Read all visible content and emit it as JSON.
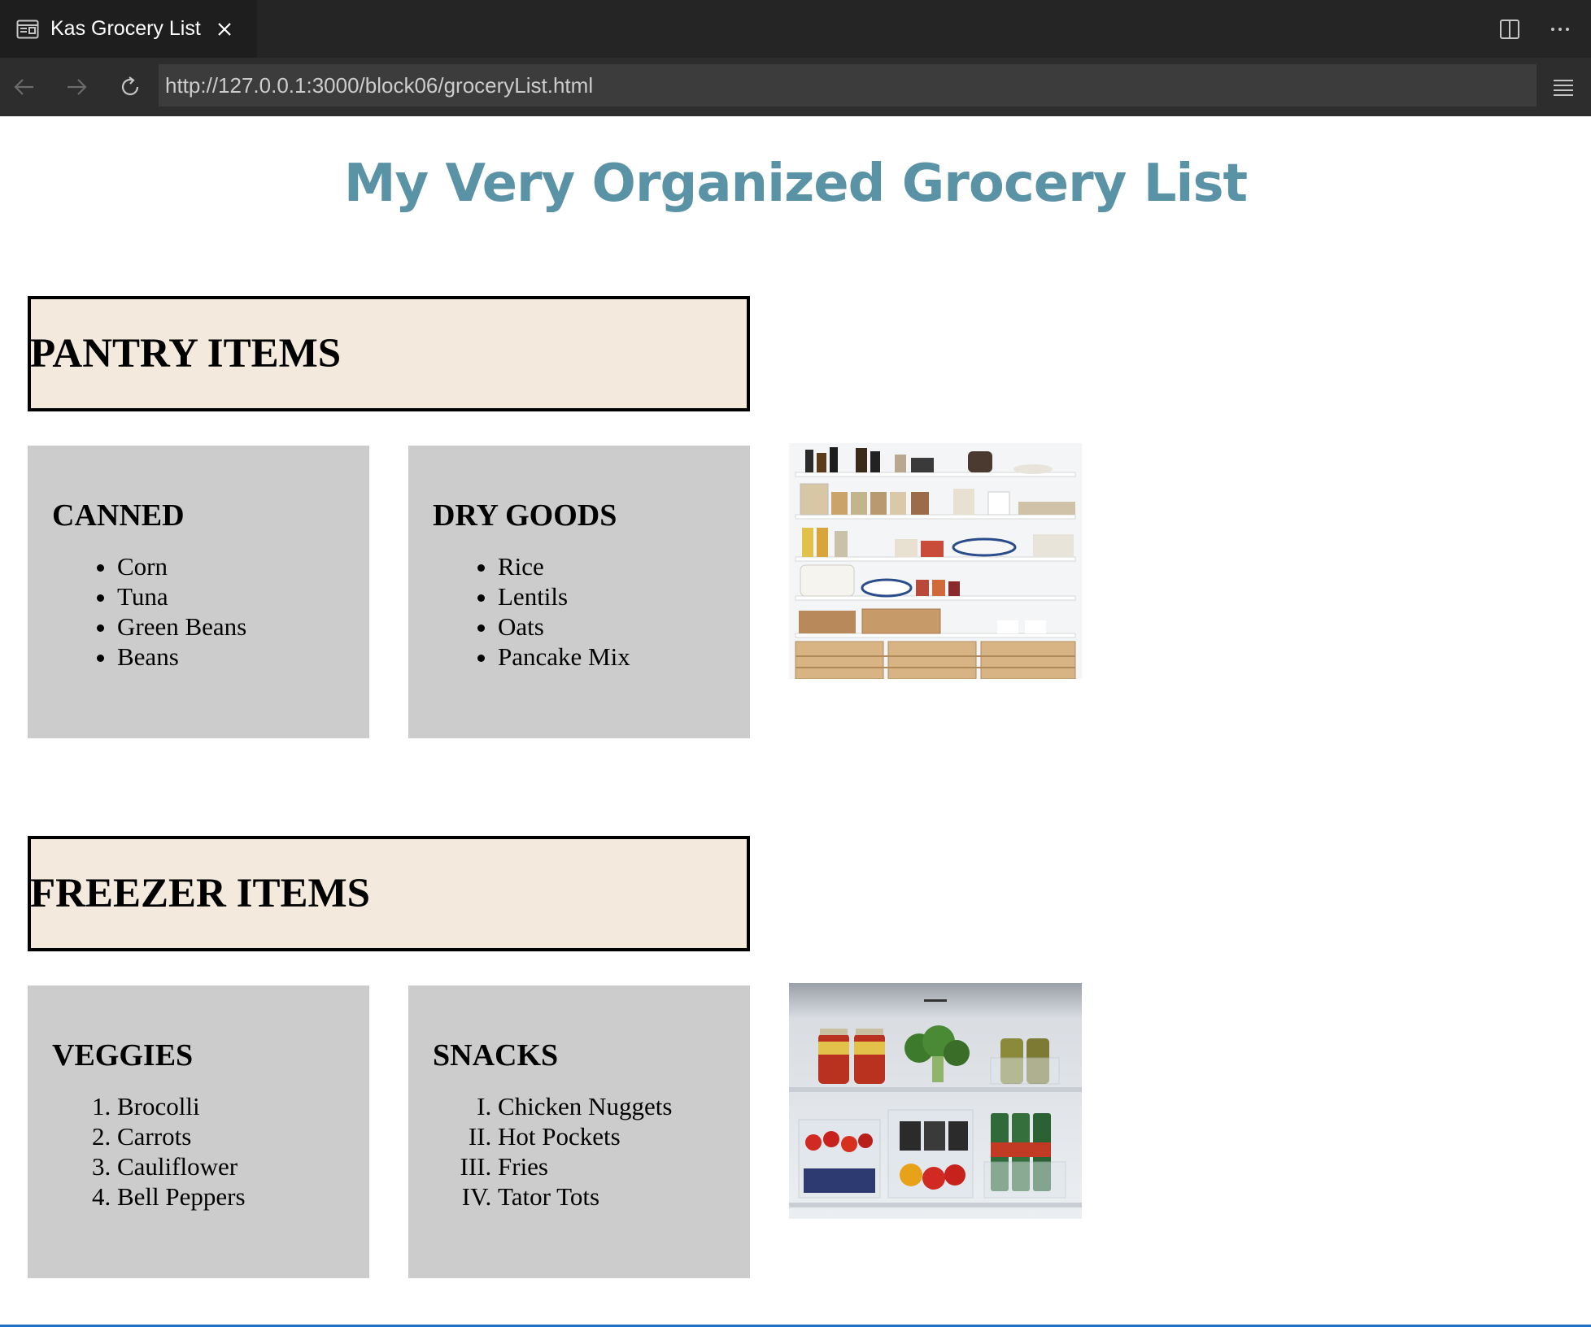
{
  "browser": {
    "tab_title": "Kas Grocery List",
    "url": "http://127.0.0.1:3000/block06/groceryList.html"
  },
  "page": {
    "title": "My Very Organized Grocery List",
    "sections": {
      "pantry": {
        "heading": "PANTRY ITEMS",
        "canned": {
          "heading": "CANNED",
          "items": [
            "Corn",
            "Tuna",
            "Green Beans",
            "Beans"
          ]
        },
        "dry_goods": {
          "heading": "DRY GOODS",
          "items": [
            "Rice",
            "Lentils",
            "Oats",
            "Pancake Mix"
          ]
        }
      },
      "freezer": {
        "heading": "FREEZER ITEMS",
        "veggies": {
          "heading": "VEGGIES",
          "items": [
            "Brocolli",
            "Carrots",
            "Cauliflower",
            "Bell Peppers"
          ]
        },
        "snacks": {
          "heading": "SNACKS",
          "items": [
            "Chicken Nuggets",
            "Hot Pockets",
            "Fries",
            "Tator Tots"
          ]
        }
      }
    }
  },
  "icons": {
    "tab": "browser-preview-icon",
    "close": "close-icon",
    "split": "split-editor-icon",
    "more": "more-actions-icon",
    "back": "arrow-left-icon",
    "forward": "arrow-right-icon",
    "reload": "reload-icon",
    "menu": "hamburger-menu-icon"
  },
  "colors": {
    "title": "#5b93a6",
    "banner_bg": "#f3e9dc",
    "card_bg": "#cccccc",
    "chrome_dark": "#252526",
    "chrome_nav": "#2d2d2d",
    "url_bg": "#3c3c3c"
  }
}
